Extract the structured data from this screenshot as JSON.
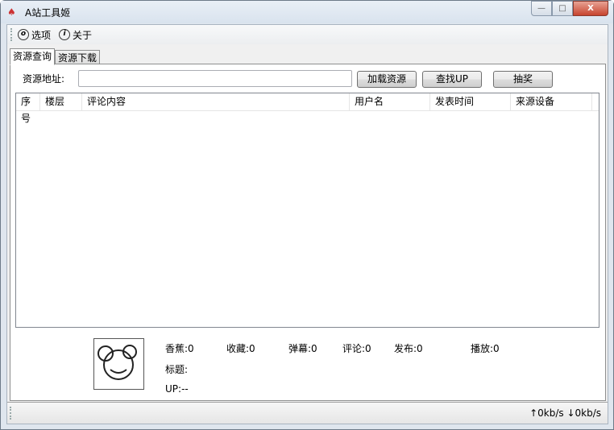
{
  "window": {
    "title": "A站工具姬",
    "minimize": "—",
    "maximize": "□",
    "close": "X"
  },
  "toolbar": {
    "options": "选项",
    "about": "关于"
  },
  "tabs": [
    "资源查询",
    "资源下载"
  ],
  "query": {
    "address_label": "资源地址:",
    "address_value": "",
    "load_button": "加载资源",
    "find_up_button": "查找UP",
    "lottery_button": "抽奖"
  },
  "table": {
    "columns": [
      "序号",
      "楼层",
      "评论内容",
      "用户名",
      "发表时间",
      "来源设备"
    ],
    "rows": []
  },
  "info": {
    "banana": "香蕉:0",
    "favorite": "收藏:0",
    "danmaku": "弹幕:0",
    "comment": "评论:0",
    "publish": "发布:0",
    "play": "播放:0",
    "title": "标题:",
    "up": "UP:--"
  },
  "status": {
    "speed": "↑0kb/s ↓0kb/s"
  }
}
